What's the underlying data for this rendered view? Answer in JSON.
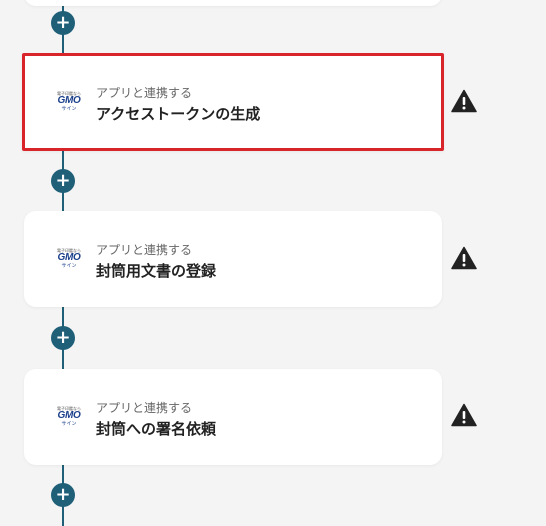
{
  "flow": {
    "add_label": "+",
    "steps": [
      {
        "subtitle": "アプリと連携する",
        "title": "アクセストークンの生成",
        "selected": true,
        "logo": {
          "tag": "電子印鑑なら",
          "main": "GMO",
          "sub": "サイン"
        }
      },
      {
        "subtitle": "アプリと連携する",
        "title": "封筒用文書の登録",
        "selected": false,
        "logo": {
          "tag": "電子印鑑なら",
          "main": "GMO",
          "sub": "サイン"
        }
      },
      {
        "subtitle": "アプリと連携する",
        "title": "封筒への署名依頼",
        "selected": false,
        "logo": {
          "tag": "電子印鑑なら",
          "main": "GMO",
          "sub": "サイン"
        }
      }
    ]
  },
  "colors": {
    "connector": "#1f5f78",
    "selected_border": "#d9242a",
    "warning": "#222222"
  },
  "icons": {
    "add": "plus-icon",
    "warning": "warning-triangle-icon",
    "logo": "gmo-sign-logo"
  }
}
